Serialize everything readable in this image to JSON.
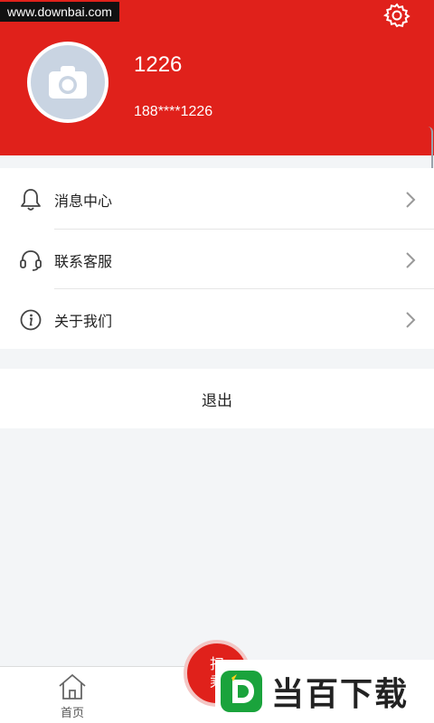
{
  "watermark": {
    "text": "www.downbai.com"
  },
  "header": {
    "user_name": "1226",
    "phone": "188****1226",
    "settings_icon": "gear-icon",
    "avatar_icon": "camera-icon"
  },
  "menu": {
    "items": [
      {
        "label": "消息中心",
        "icon": "bell-icon"
      },
      {
        "label": "联系客服",
        "icon": "headset-icon"
      },
      {
        "label": "关于我们",
        "icon": "info-icon"
      }
    ]
  },
  "logout": {
    "label": "退出"
  },
  "tabbar": {
    "home_label": "首页",
    "scan_label_line1": "扫",
    "scan_label_line2": "乘"
  },
  "brand": {
    "text": "当百下载",
    "logo_letter": "D"
  },
  "colors": {
    "accent": "#e0211b",
    "background": "#f3f5f7"
  }
}
